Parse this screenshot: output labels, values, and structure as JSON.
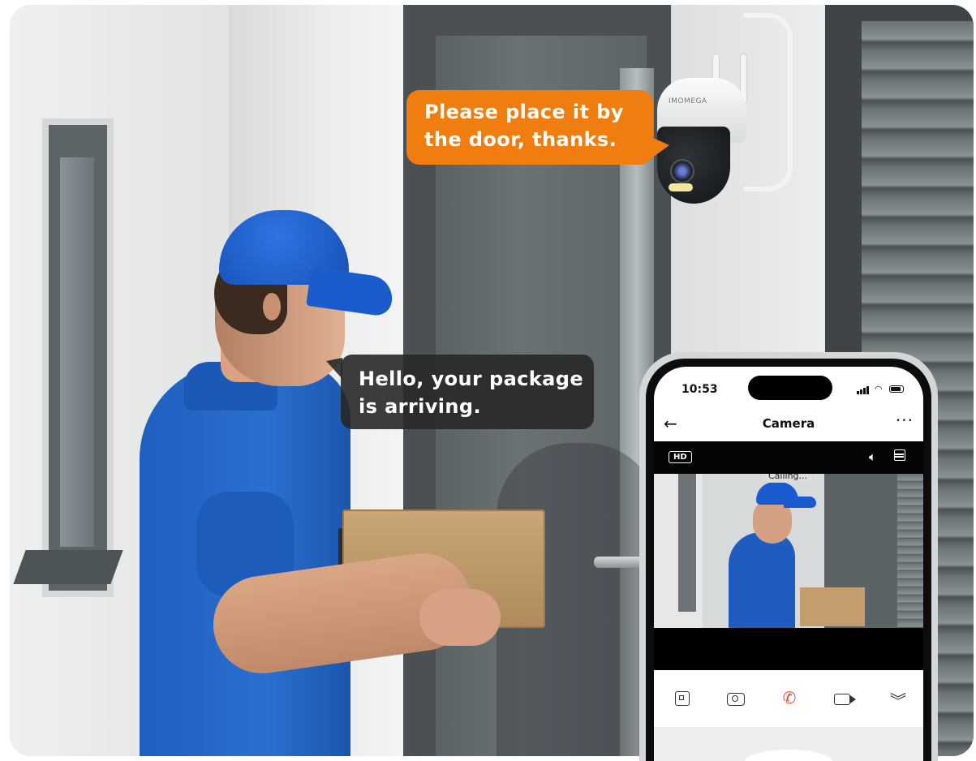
{
  "scene": {
    "speech_camera": "Please place it by the door, thanks.",
    "speech_courier": "Hello, your package is arriving.",
    "camera_brand": "IMOMEGA"
  },
  "phone": {
    "status_time": "10:53",
    "title": "Camera",
    "quality_badge": "HD",
    "call_status": "Calling...",
    "icons": {
      "back": "arrow-left-icon",
      "more": "ellipsis-icon",
      "speaker": "speaker-icon",
      "layout": "layout-icon",
      "screenshot": "screenshot-icon",
      "snapshot": "camera-icon",
      "call": "phone-call-icon",
      "record": "video-record-icon",
      "collapse": "chevron-down-icon"
    },
    "colors": {
      "call_active": "#e0482e",
      "bubble_camera": "#f07d10",
      "bubble_courier": "#282828"
    }
  }
}
